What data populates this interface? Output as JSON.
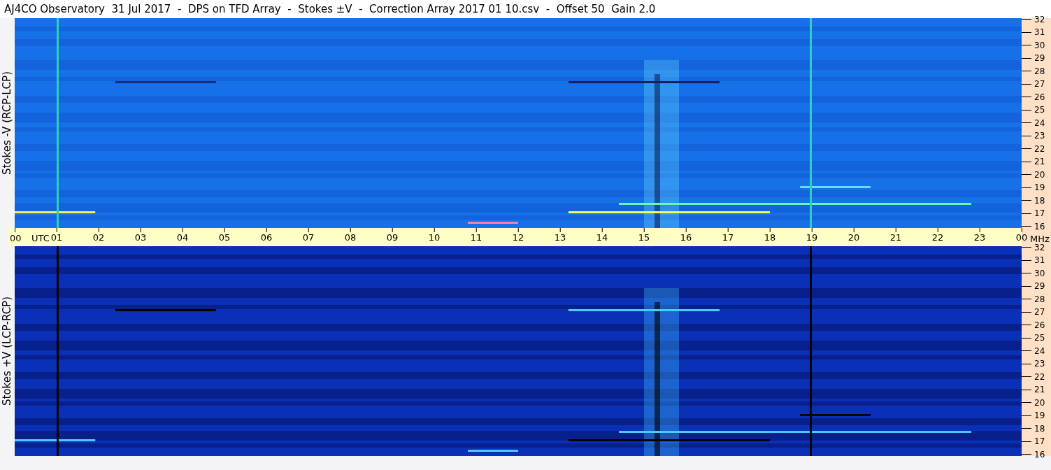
{
  "title": "AJ4CO Observatory  31 Jul 2017  -  DPS on TFD Array  -  Stokes ±V  -  Correction Array 2017 01 10.csv  -  Offset 50  Gain 2.0",
  "panels": [
    {
      "kind": "rcp",
      "label": "Stokes -V (RCP-LCP)",
      "freq_ticks": [
        "32",
        "31",
        "30",
        "29",
        "28",
        "27",
        "26",
        "25",
        "24",
        "23",
        "22",
        "21",
        "20",
        "19",
        "18",
        "17",
        "16"
      ]
    },
    {
      "kind": "lcp",
      "label": "Stokes +V (LCP-RCP)",
      "freq_ticks": [
        "32",
        "31",
        "30",
        "29",
        "28",
        "27",
        "26",
        "25",
        "24",
        "23",
        "22",
        "21",
        "20",
        "19",
        "18",
        "17",
        "16"
      ]
    }
  ],
  "time_axis": {
    "start_label": "00",
    "unit_label": "UTC",
    "hours": [
      "01",
      "02",
      "03",
      "04",
      "05",
      "06",
      "07",
      "08",
      "09",
      "10",
      "11",
      "12",
      "13",
      "14",
      "15",
      "16",
      "17",
      "18",
      "19",
      "20",
      "21",
      "22",
      "23",
      "00"
    ],
    "freq_unit": "MHz"
  }
}
